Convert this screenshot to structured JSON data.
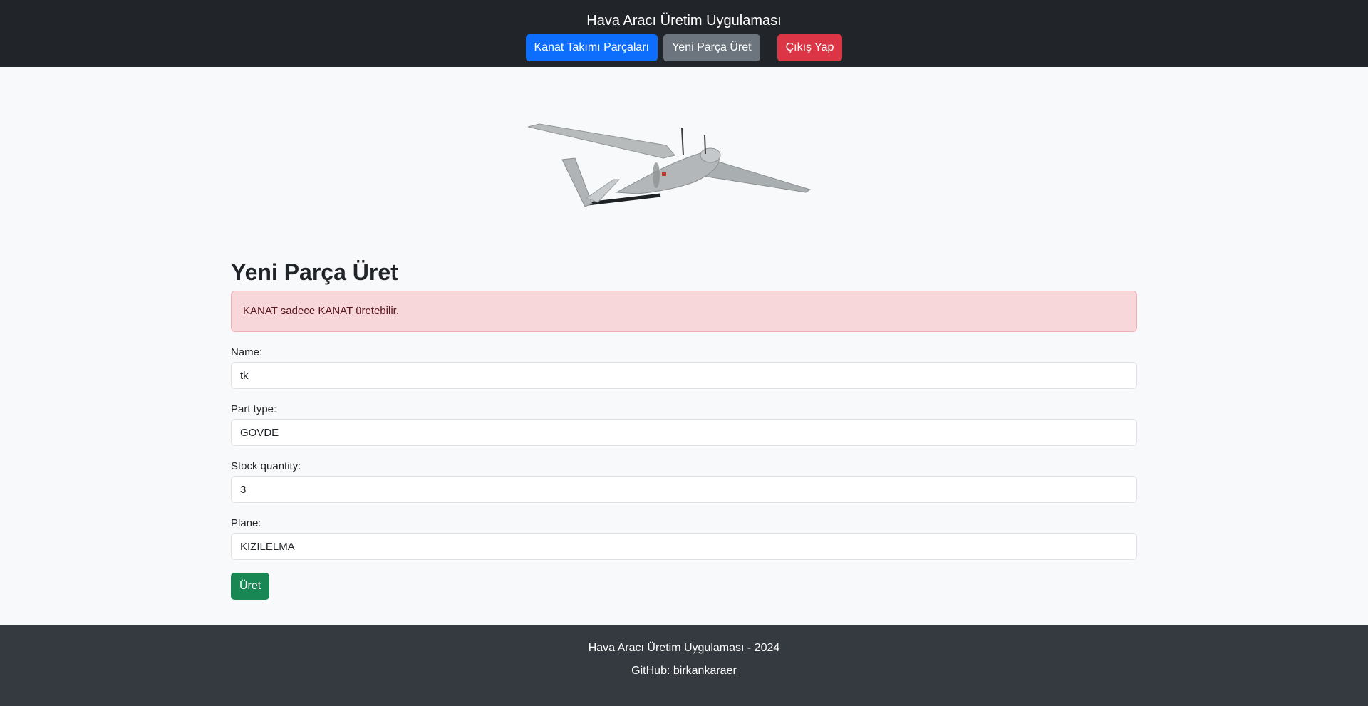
{
  "header": {
    "title": "Hava Aracı Üretim Uygulaması",
    "nav": {
      "parts_label": "Kanat Takımı Parçaları",
      "new_part_label": "Yeni Parça Üret",
      "logout_label": "Çıkış Yap"
    }
  },
  "colors": {
    "header_bg": "#212529",
    "primary": "#0d6efd",
    "secondary": "#6c757d",
    "danger": "#dc3545",
    "success": "#198754",
    "alert_bg": "#f8d7da",
    "footer_bg": "#343a40"
  },
  "hero": {
    "icon": "drone-image"
  },
  "main": {
    "title": "Yeni Parça Üret",
    "alert": "KANAT sadece KANAT üretebilir.",
    "fields": [
      {
        "label": "Name:",
        "value": "tk"
      },
      {
        "label": "Part type:",
        "value": "GOVDE"
      },
      {
        "label": "Stock quantity:",
        "value": "3"
      },
      {
        "label": "Plane:",
        "value": "KIZILELMA"
      }
    ],
    "submit_label": "Üret"
  },
  "footer": {
    "copyright": "Hava Aracı Üretim Uygulaması - 2024",
    "github_prefix": "GitHub:",
    "github_link": "birkankaraer"
  }
}
